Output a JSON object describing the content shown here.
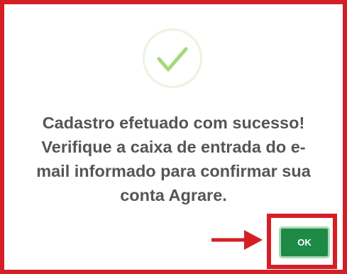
{
  "dialog": {
    "message_line_1": "Cadastro efetuado com sucesso!",
    "message_line_2": "Verifique a caixa de entrada do e-",
    "message_line_3": "mail informado para confirmar sua",
    "message_line_4": "conta Agrare.",
    "ok_label": "OK",
    "success_icon": "checkmark-icon"
  },
  "colors": {
    "highlight": "#d41f26",
    "button": "#1f8a45",
    "check": "#a5d87c",
    "text": "#555555"
  }
}
